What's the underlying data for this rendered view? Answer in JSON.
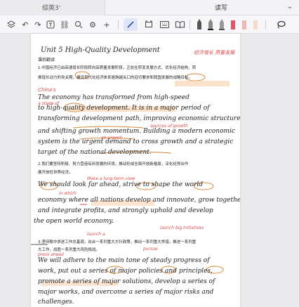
{
  "titlebar": {
    "left_tab": "综英3'",
    "active_tab": "读写"
  },
  "toolbar": {
    "tools": [
      "layers-icon",
      "undo-icon",
      "redo-icon",
      "text-box-icon",
      "link-icon",
      "search-icon",
      "settings-icon",
      "add-icon",
      "pen-icon",
      "frame-icon",
      "keyboard-icon",
      "book-icon",
      "marker-icon",
      "pen-color-icon",
      "pen-width-icon",
      "highlighter-red-icon",
      "highlighter-pink-icon",
      "highlighter-light-icon",
      "lasso-icon"
    ]
  },
  "page": {
    "unit_title": "Unit 5  High-Quality Development",
    "unit_note": "经济增长 质量发展",
    "section1": "课后翻译",
    "p1_cn_a": "1.中国经济已由高速增长阶段转向高质量发展阶段，正处在转变发展方式、优化经济结构、转",
    "p1_cn_b": "换增长动力的攻关期，建设现代化经济体系是跨越关口的迫切要求和我国发展的战略目标。",
    "p1_en_1": "The economy has transformed from high-speed",
    "p1_en_2": "to high-quality development. It is in a major period of",
    "p1_en_3": "transforming development path, improving economic structure",
    "p1_en_4": "and shifting growth momentum. Building a modern economic",
    "p1_en_5": "system is the urgent demand to cross growth and a strategic",
    "p1_en_6": "target of the national development.",
    "p2_cn_a": "2.我们要坚持积极、努力营造有利发展的环境，推动形成全面开放新格局，深化经贸合作",
    "p2_cn_b": "展开放性世界经济。",
    "p2_en_1": "We should look far ahead, strive to shape the world",
    "p2_en_2": "economy where all nations develop and innovate, grow together",
    "p2_en_3": "and integrate profits, and strongly uphold and develop",
    "p2_en_4": "the open world economy.",
    "p3_cn_a": "3.坚持稳中求进工作总基调，出台一系列重大方针政策，推出一系列重大举措，推进一系列重",
    "p3_cn_b": "大工作，战胜一系列重大风险挑战。",
    "p3_en_1": "We will adhere to the main tone of steady progress of",
    "p3_en_2": "work, put out a series of major policies and principles,",
    "p3_en_3": "promote a series of major solutions, develop a series of",
    "p3_en_4": "major works, and overcome a series of major risks and",
    "p3_en_5": "challenges.",
    "red_notes": [
      "China's",
      "a stage of",
      "Make a long-term view",
      "launch a",
      "in which",
      "pursue",
      "launch big initiatives",
      "press ahead",
      "sources of growth",
      "an urgent"
    ]
  },
  "colors": {
    "highlight": "#f8c496",
    "ink_red": "#d94a4a",
    "circle": "#d8873a",
    "toolbar_bg": "#f7f7f9"
  }
}
